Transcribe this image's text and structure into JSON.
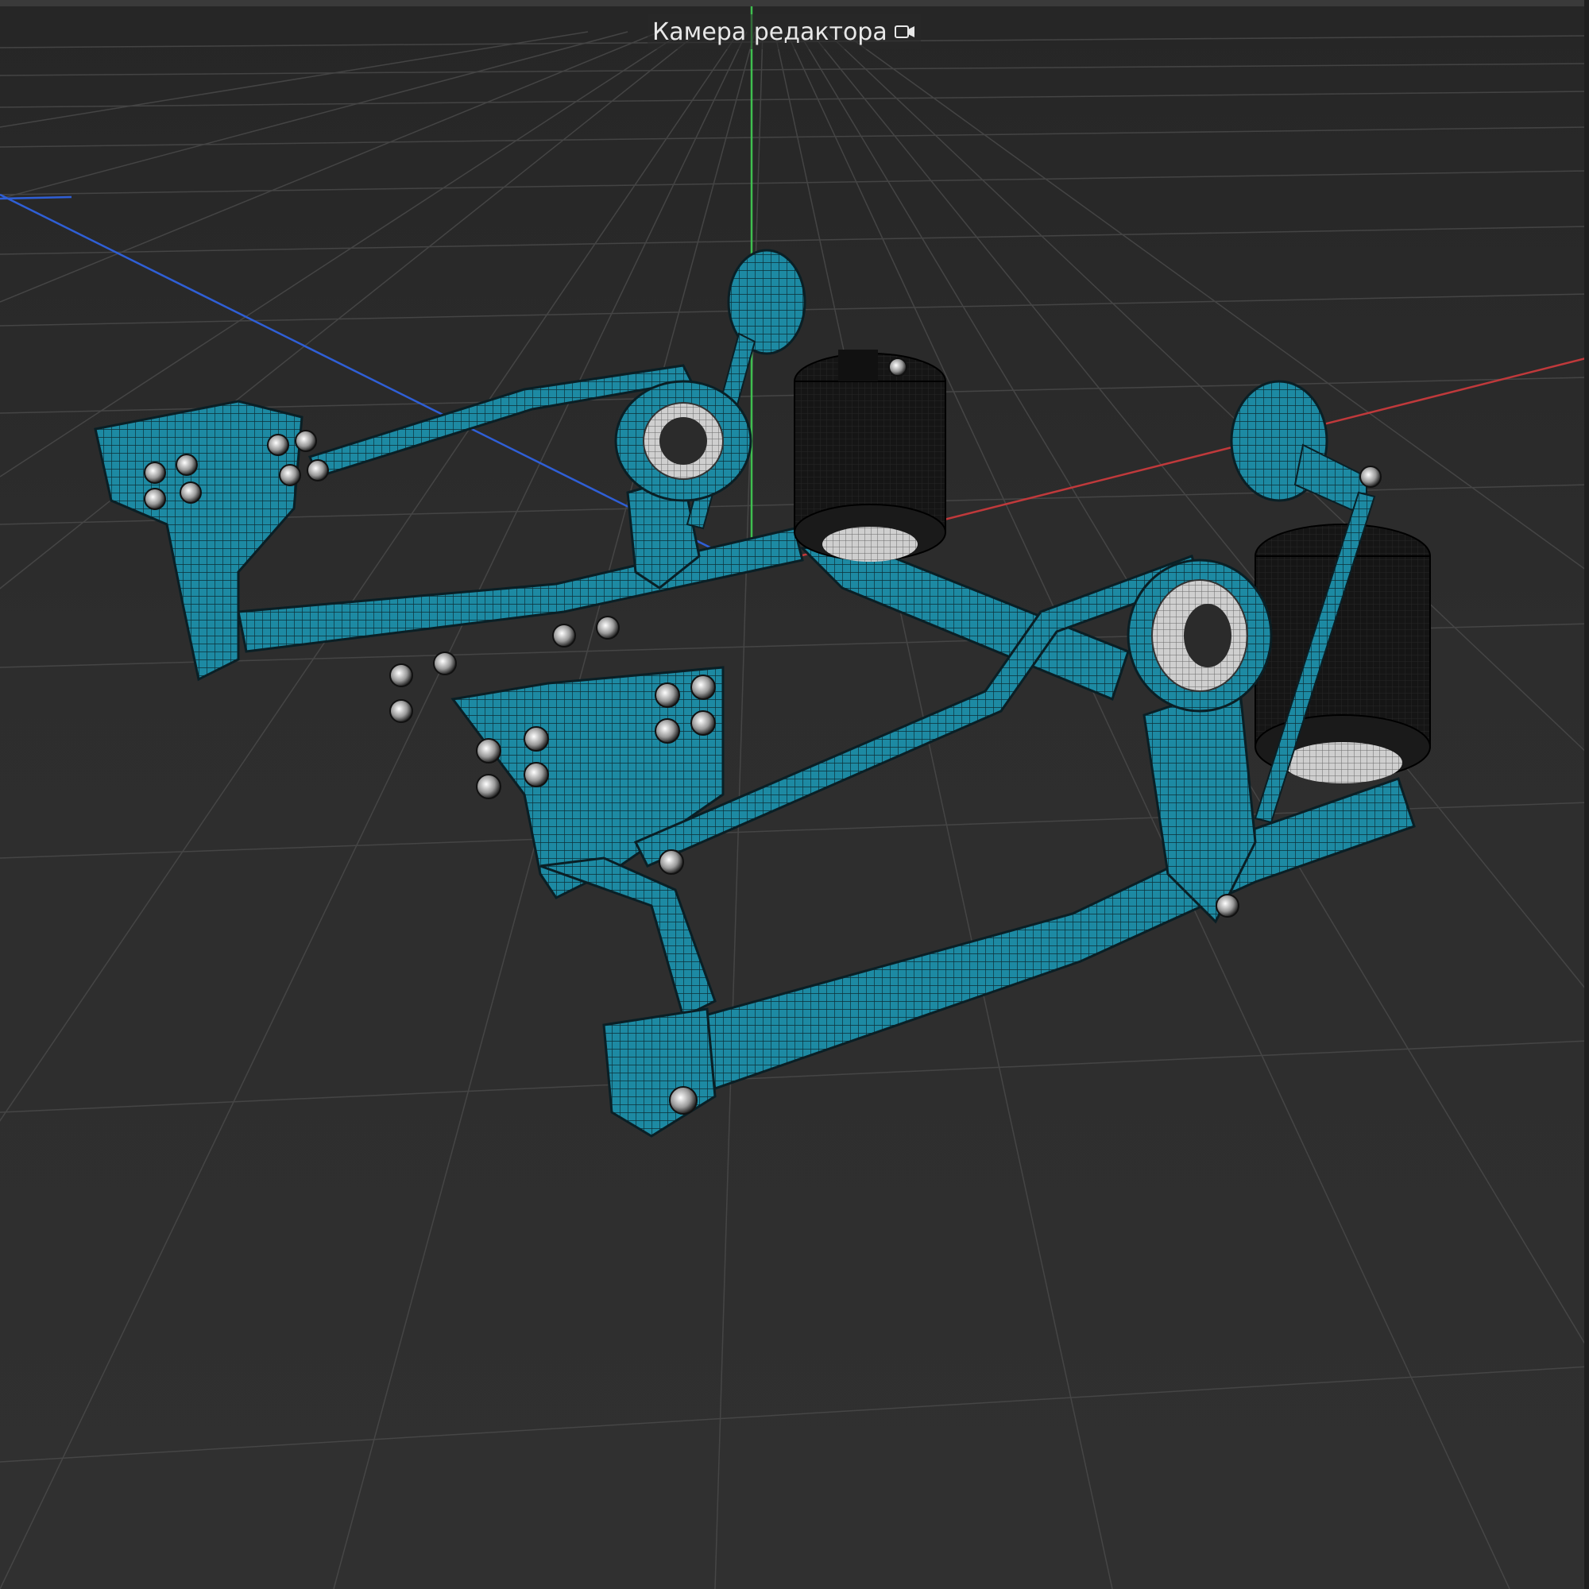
{
  "viewport": {
    "camera_label": "Камера редактора",
    "camera_icon": "camera-icon"
  },
  "colors": {
    "background": "#2b2b2b",
    "grid": "#4a4a4a",
    "axis_x": "#c0393b",
    "axis_y": "#3fbf4f",
    "axis_z": "#2f5fd6",
    "model_body": "#1d8aa3",
    "model_wire": "#0d2f38",
    "air_bag": "#141414",
    "bolt": "#d8d8d8"
  },
  "scene": {
    "object": "suspension-model",
    "display_mode": "wireframe-shaded"
  }
}
